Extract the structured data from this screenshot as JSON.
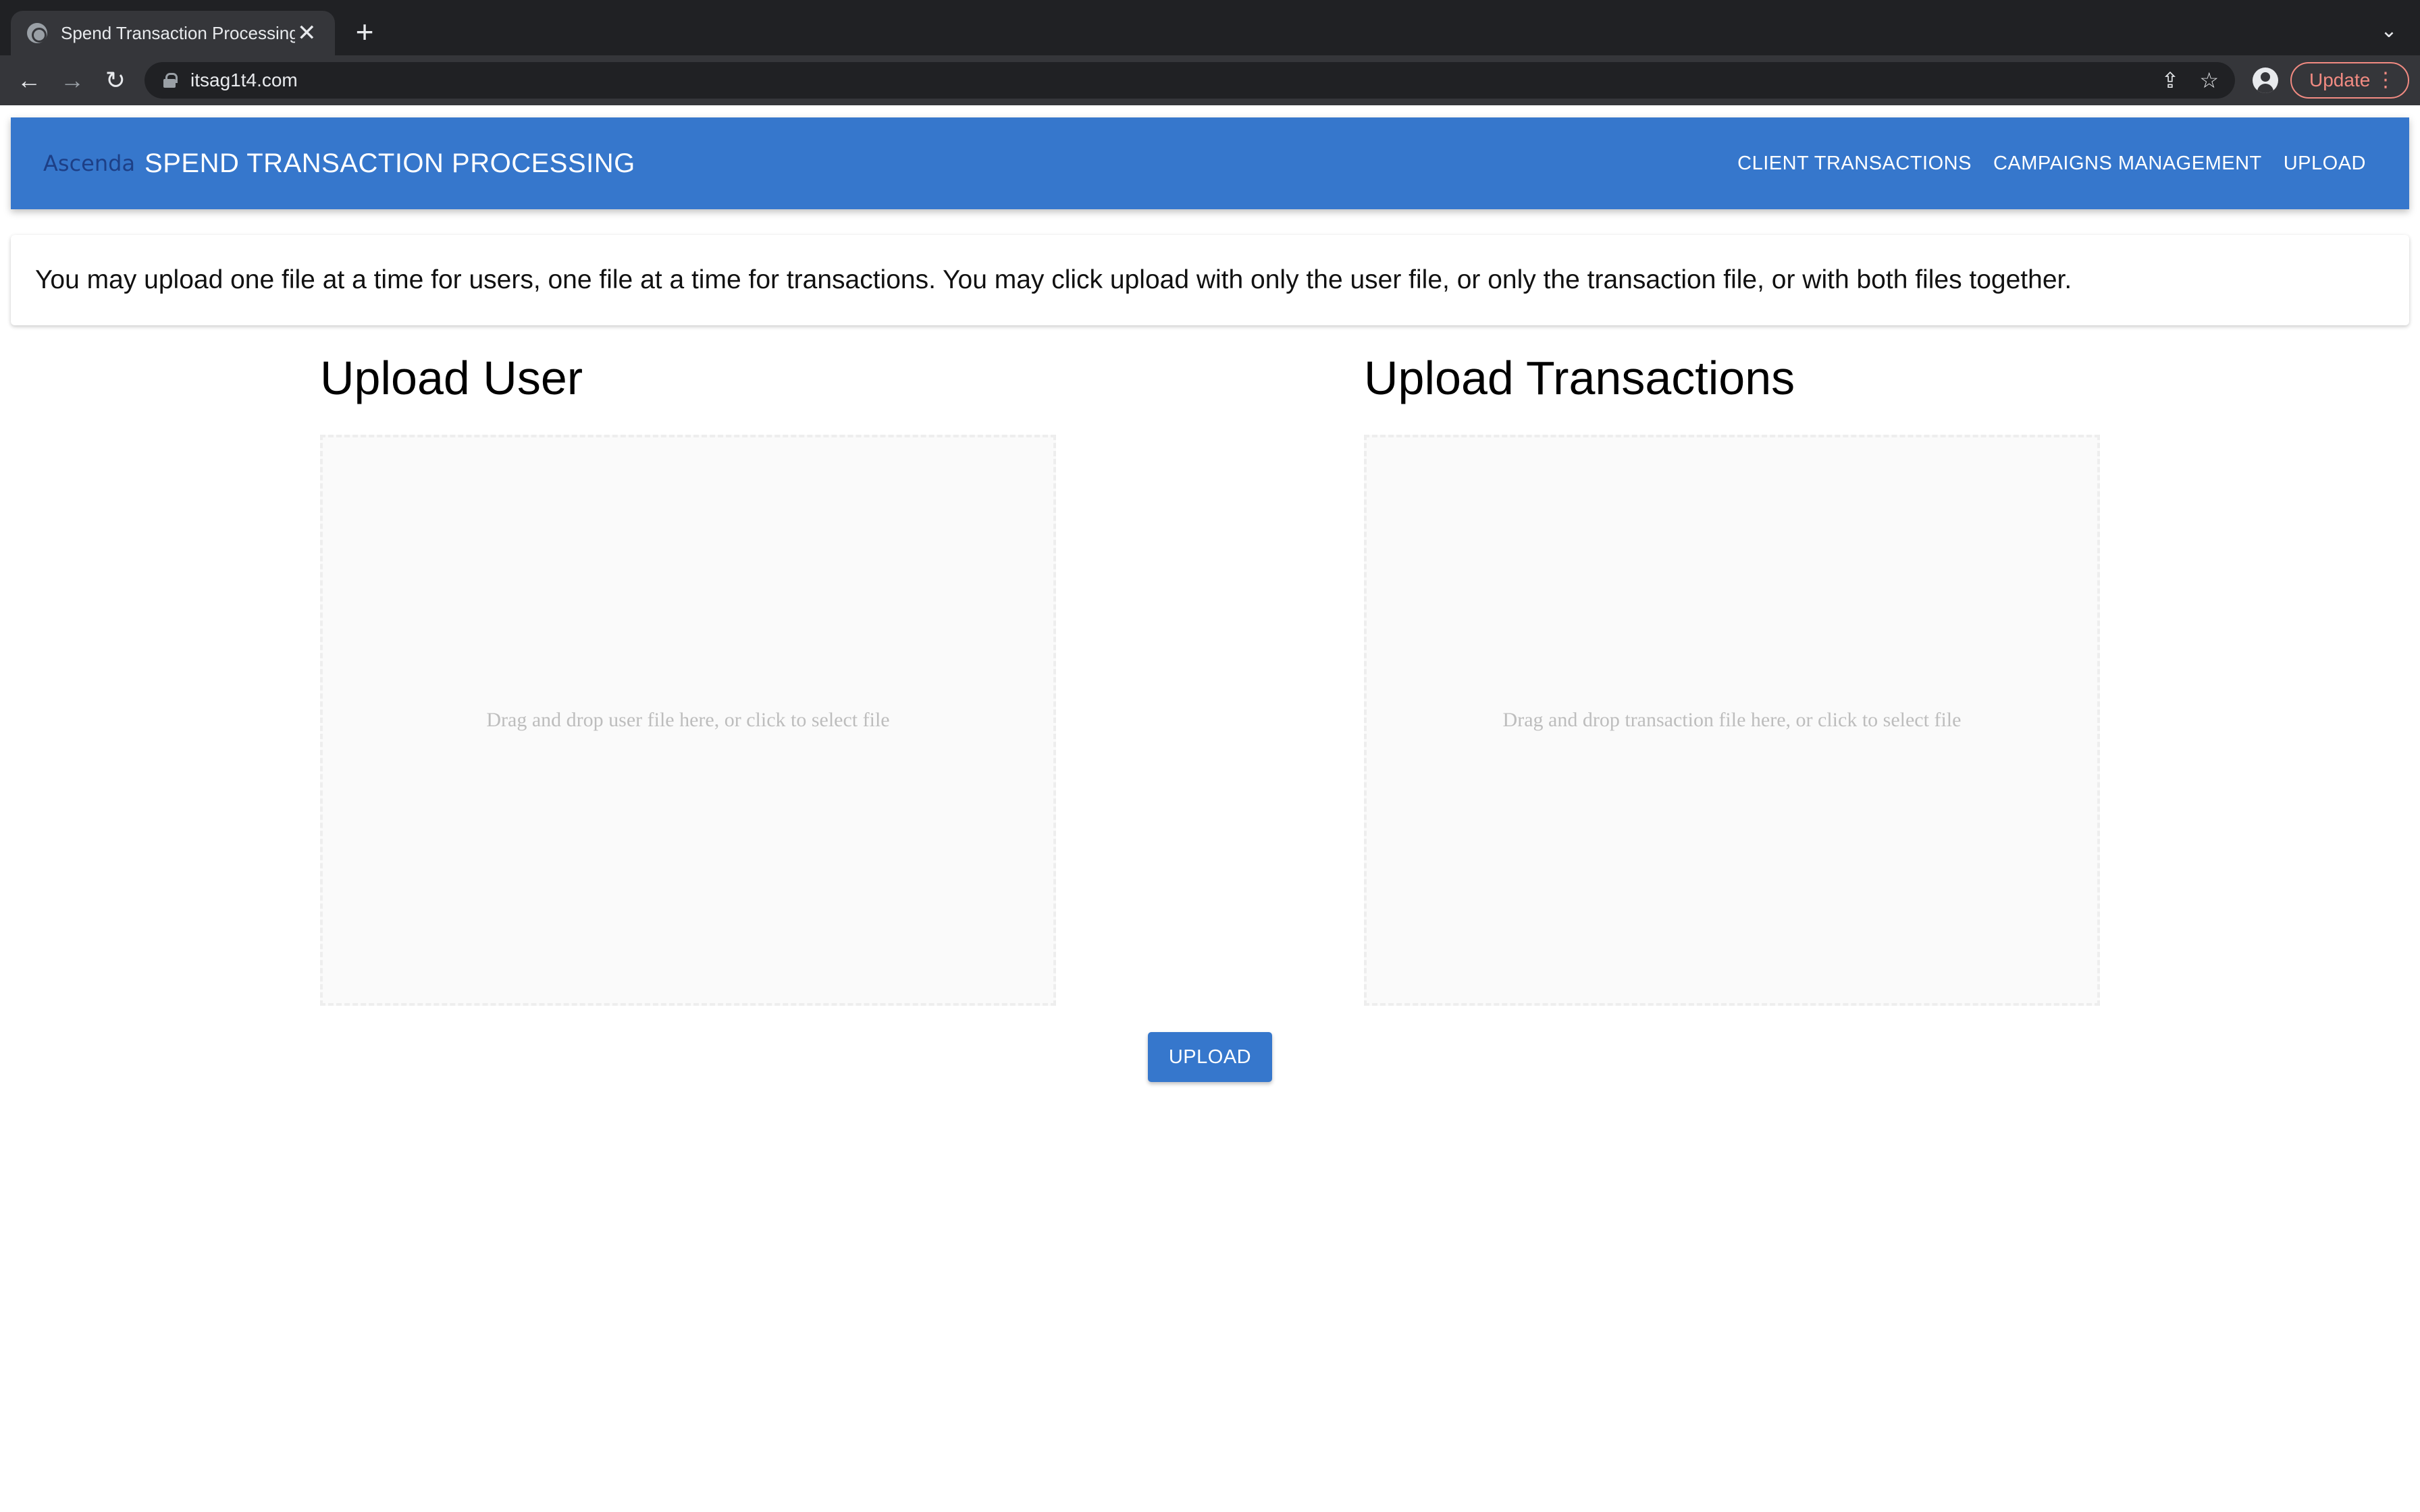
{
  "browser": {
    "tab_title": "Spend Transaction Processing",
    "url": "itsag1t4.com",
    "update_label": "Update",
    "icons": {
      "favicon": "globe-icon",
      "close": "close-icon",
      "new_tab": "plus-icon",
      "tab_menu": "chevron-down-icon",
      "back": "arrow-left-icon",
      "forward": "arrow-right-icon",
      "reload": "reload-icon",
      "lock": "lock-icon",
      "share": "share-icon",
      "bookmark": "star-icon",
      "profile": "profile-icon",
      "menu": "kebab-menu-icon"
    },
    "glyphs": {
      "close": "✕",
      "new_tab": "+",
      "tab_menu": "⌄",
      "back": "←",
      "forward": "→",
      "reload": "↻",
      "share": "⇪",
      "bookmark": "☆",
      "menu": "⋮"
    }
  },
  "header": {
    "logo": "Ascenda",
    "title": "SPEND TRANSACTION PROCESSING",
    "nav": [
      "CLIENT TRANSACTIONS",
      "CAMPAIGNS MANAGEMENT",
      "UPLOAD"
    ]
  },
  "info": {
    "text": "You may upload one file at a time for users, one file at a time for transactions. You may click upload with only the user file, or only the transaction file, or with both files together."
  },
  "upload_user": {
    "title": "Upload User",
    "dropzone_text": "Drag and drop user file here, or click to select file"
  },
  "upload_transactions": {
    "title": "Upload Transactions",
    "dropzone_text": "Drag and drop transaction file here, or click to select file"
  },
  "upload_button": "UPLOAD",
  "colors": {
    "header_bg": "#3677cc",
    "button_bg": "#3677cc",
    "chrome_dark": "#202124",
    "chrome_toolbar": "#35363a",
    "update_accent": "#f28b82",
    "dropzone_bg": "#fafafa",
    "dropzone_text": "#bdbdbd"
  }
}
